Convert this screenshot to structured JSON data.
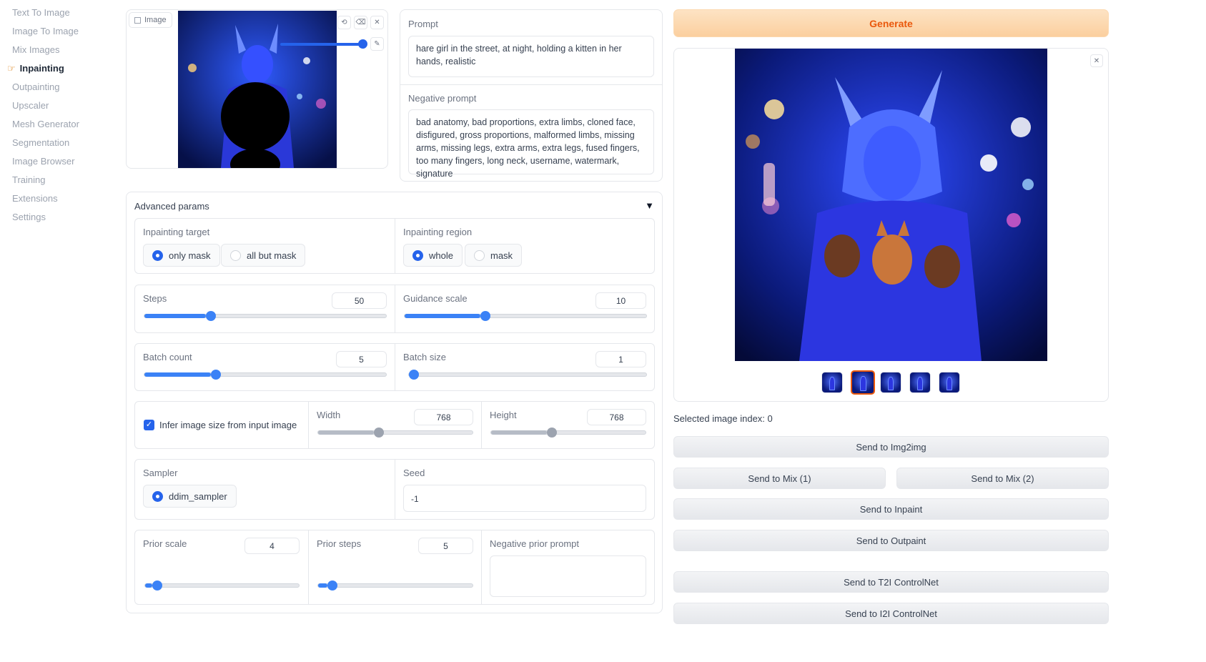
{
  "sidebar": {
    "items": [
      {
        "label": "Text To Image",
        "active": false
      },
      {
        "label": "Image To Image",
        "active": false
      },
      {
        "label": "Mix Images",
        "active": false
      },
      {
        "label": "Inpainting",
        "active": true
      },
      {
        "label": "Outpainting",
        "active": false
      },
      {
        "label": "Upscaler",
        "active": false
      },
      {
        "label": "Mesh Generator",
        "active": false
      },
      {
        "label": "Segmentation",
        "active": false
      },
      {
        "label": "Image Browser",
        "active": false
      },
      {
        "label": "Training",
        "active": false
      },
      {
        "label": "Extensions",
        "active": false
      },
      {
        "label": "Settings",
        "active": false
      }
    ]
  },
  "image_input": {
    "label": "Image"
  },
  "prompt": {
    "label": "Prompt",
    "value": "hare girl in the street, at night, holding a kitten in her hands, realistic"
  },
  "negative_prompt": {
    "label": "Negative prompt",
    "value": "bad anatomy, bad proportions, extra limbs, cloned face, disfigured, gross proportions, malformed limbs, missing arms, missing legs, extra arms, extra legs, fused fingers, too many fingers, long neck, username, watermark, signature"
  },
  "advanced": {
    "title": "Advanced params",
    "inpainting_target": {
      "label": "Inpainting target",
      "options": [
        "only mask",
        "all but mask"
      ],
      "selected": "only mask"
    },
    "inpainting_region": {
      "label": "Inpainting region",
      "options": [
        "whole",
        "mask"
      ],
      "selected": "whole"
    },
    "steps": {
      "label": "Steps",
      "value": "50",
      "fraction": 0.255
    },
    "guidance_scale": {
      "label": "Guidance scale",
      "value": "10",
      "fraction": 0.315
    },
    "batch_count": {
      "label": "Batch count",
      "value": "5",
      "fraction": 0.275
    },
    "batch_size": {
      "label": "Batch size",
      "value": "1",
      "fraction": 0.0
    },
    "infer_size": {
      "label": "Infer image size from input image",
      "checked": true
    },
    "width": {
      "label": "Width",
      "value": "768",
      "fraction": 0.36
    },
    "height": {
      "label": "Height",
      "value": "768",
      "fraction": 0.36
    },
    "sampler": {
      "label": "Sampler",
      "options": [
        "ddim_sampler"
      ],
      "selected": "ddim_sampler"
    },
    "seed": {
      "label": "Seed",
      "value": "-1"
    },
    "prior_scale": {
      "label": "Prior scale",
      "value": "4",
      "fraction": 0.045
    },
    "prior_steps": {
      "label": "Prior steps",
      "value": "5",
      "fraction": 0.06
    },
    "negative_prior_prompt": {
      "label": "Negative prior prompt",
      "value": ""
    }
  },
  "output": {
    "generate_label": "Generate",
    "selected_index_text": "Selected image index: 0",
    "thumbnail_count": 5,
    "selected_thumbnail": 1,
    "buttons": {
      "img2img": "Send to Img2img",
      "mix1": "Send to Mix (1)",
      "mix2": "Send to Mix (2)",
      "inpaint": "Send to Inpaint",
      "outpaint": "Send to Outpaint",
      "t2i_controlnet": "Send to T2I ControlNet",
      "i2i_controlnet": "Send to I2I ControlNet"
    }
  },
  "colors": {
    "accent": "#3b82f6",
    "generate_bg": "#fdd9b0",
    "generate_text": "#ea580c"
  }
}
